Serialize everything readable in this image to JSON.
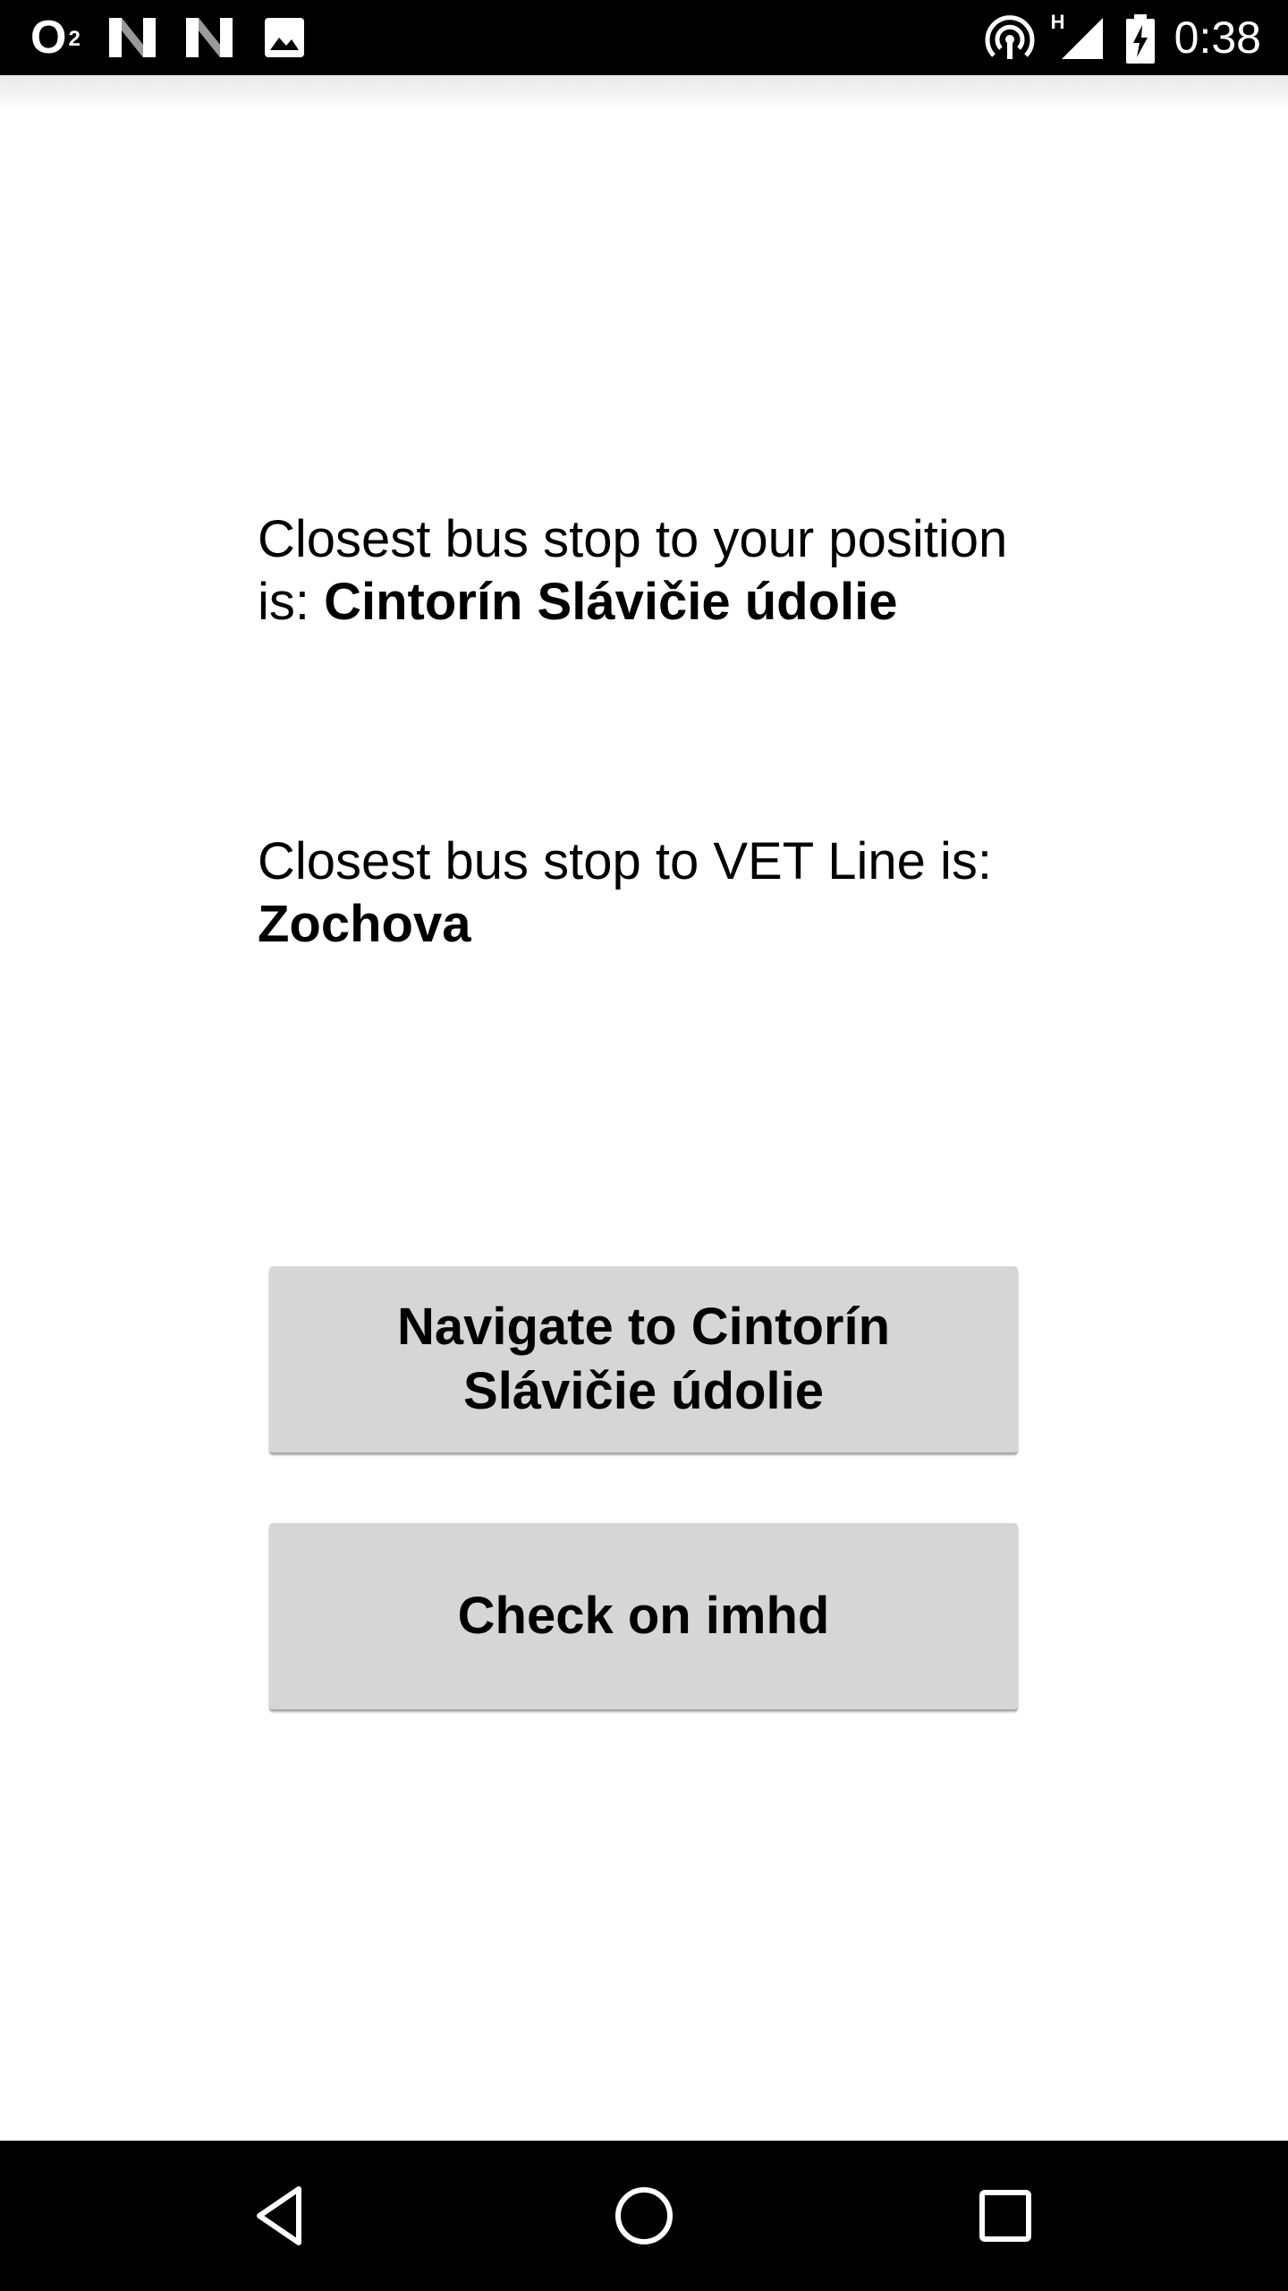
{
  "status_bar": {
    "carrier": "O",
    "carrier_sub": "2",
    "time": "0:38",
    "network_type": "H",
    "icons_left": [
      "carrier-o2-icon",
      "notification-n-icon",
      "notification-n-icon",
      "image-icon"
    ],
    "icons_right": [
      "hotspot-icon",
      "signal-icon",
      "battery-charging-icon"
    ]
  },
  "content": {
    "position_stop": {
      "prefix": "Closest bus stop to your position is: ",
      "name": "Cintorín Slávičie údolie"
    },
    "vet_stop": {
      "prefix": "Closest bus stop to VET Line is: ",
      "name": "Zochova"
    }
  },
  "buttons": {
    "navigate_label": "Navigate to Cintorín Slávičie údolie",
    "imhd_label": "Check on imhd"
  },
  "nav_bar": {
    "icons": [
      "back-icon",
      "home-icon",
      "recents-icon"
    ]
  },
  "colors": {
    "status_bar_bg": "#000000",
    "button_bg": "#d6d6d6",
    "page_bg": "#ffffff"
  }
}
